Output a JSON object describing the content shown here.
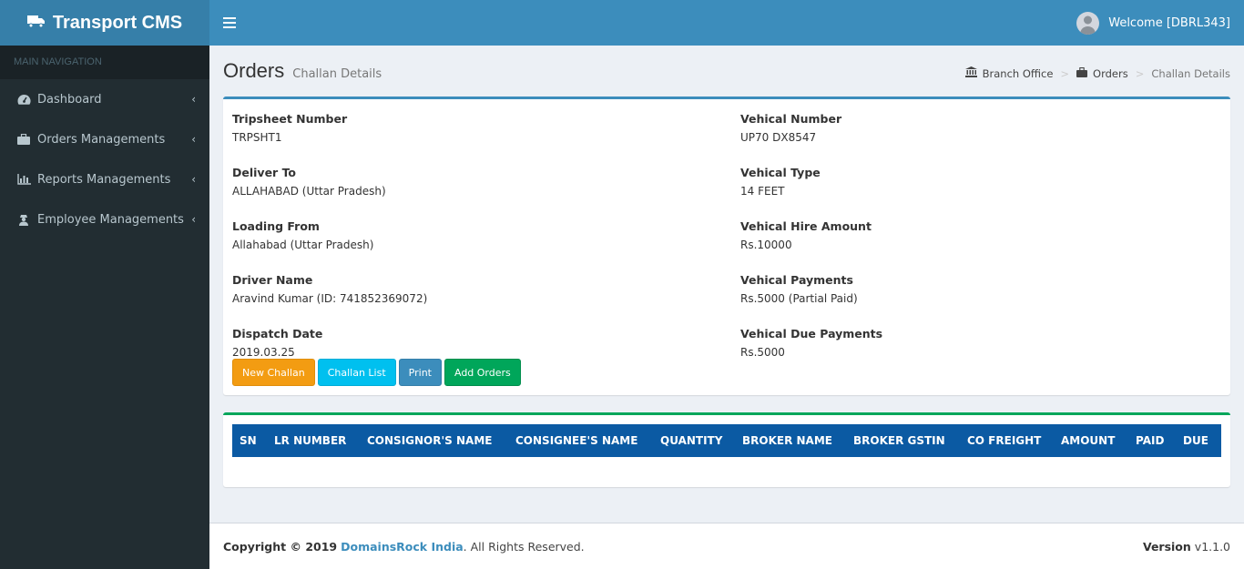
{
  "app": {
    "title": "Transport CMS",
    "welcome": "Welcome [DBRL343]"
  },
  "sidebar": {
    "header": "MAIN NAVIGATION",
    "items": [
      {
        "label": "Dashboard",
        "icon": "dashboard-icon"
      },
      {
        "label": "Orders Managements",
        "icon": "briefcase-icon"
      },
      {
        "label": "Reports Managements",
        "icon": "bar-chart-icon"
      },
      {
        "label": "Employee Managements",
        "icon": "user-secret-icon"
      }
    ]
  },
  "page": {
    "title": "Orders",
    "subtitle": "Challan Details"
  },
  "breadcrumb": {
    "home": "Branch Office",
    "orders": "Orders",
    "current": "Challan Details",
    "separator": ">"
  },
  "details": {
    "left": [
      {
        "label": "Tripsheet Number",
        "value": "TRPSHT1"
      },
      {
        "label": "Deliver To",
        "value": "ALLAHABAD (Uttar Pradesh)"
      },
      {
        "label": "Loading From",
        "value": "Allahabad (Uttar Pradesh)"
      },
      {
        "label": "Driver Name",
        "value": "Aravind Kumar (ID: 741852369072)"
      },
      {
        "label": "Dispatch Date",
        "value": "2019.03.25"
      }
    ],
    "right": [
      {
        "label": "Vehical Number",
        "value": "UP70 DX8547"
      },
      {
        "label": "Vehical Type",
        "value": "14 FEET"
      },
      {
        "label": "Vehical Hire Amount",
        "value": "Rs.10000"
      },
      {
        "label": "Vehical Payments",
        "value": "Rs.5000 (Partial Paid)"
      },
      {
        "label": "Vehical Due Payments",
        "value": "Rs.5000"
      }
    ]
  },
  "buttons": {
    "new_challan": "New Challan",
    "challan_list": "Challan List",
    "print": "Print",
    "add_orders": "Add Orders"
  },
  "table": {
    "columns": [
      "SN",
      "LR NUMBER",
      "CONSIGNOR'S NAME",
      "CONSIGNEE'S NAME",
      "QUANTITY",
      "BROKER NAME",
      "BROKER GSTIN",
      "CO FREIGHT",
      "AMOUNT",
      "PAID",
      "DUE"
    ]
  },
  "footer": {
    "copyright": "Copyright © 2019",
    "company": "DomainsRock India",
    "rights": ". All Rights Reserved.",
    "version_label": "Version",
    "version": "v1.1.0"
  },
  "colors": {
    "header_blue": "#3c8dbc",
    "logo_blue": "#367fa9",
    "sidebar_dark": "#222d32",
    "table_header": "#0b5aa3",
    "box_green": "#00a65a"
  }
}
